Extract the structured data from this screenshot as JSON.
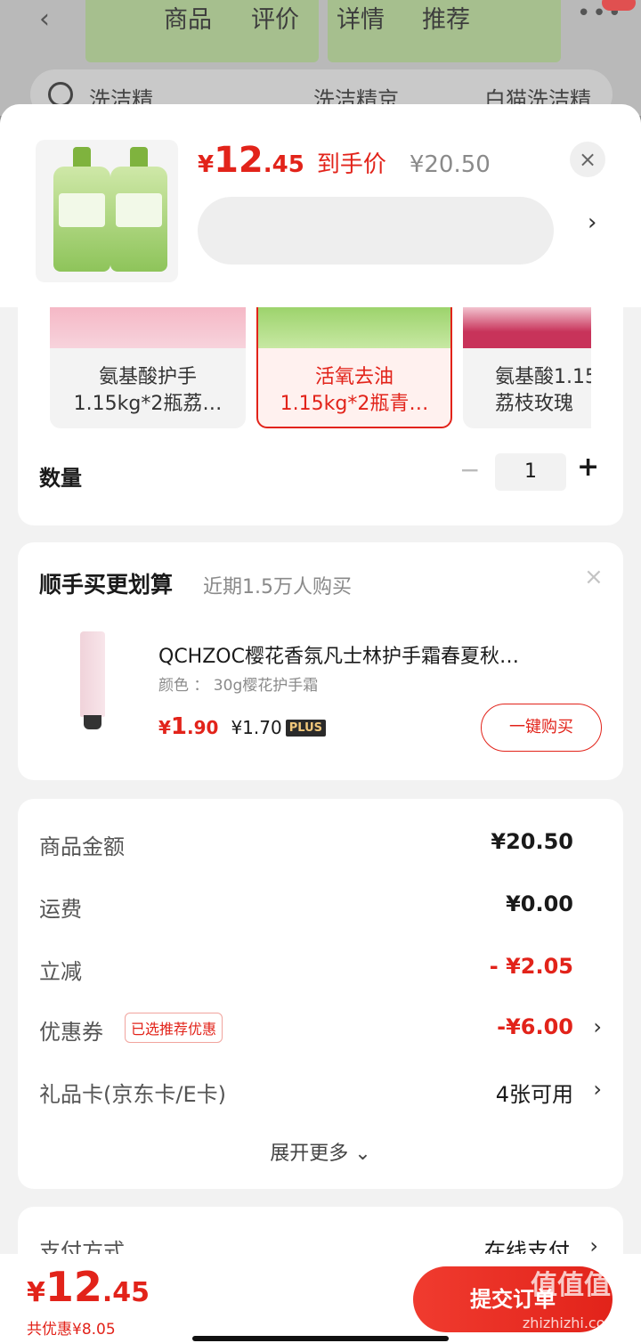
{
  "background": {
    "tabs": [
      "商品",
      "评价",
      "详情",
      "推荐"
    ],
    "search_keywords": [
      "洗洁精",
      "洗洁精京…",
      "白猫洗洁精"
    ]
  },
  "header": {
    "price_symbol": "¥",
    "price_int": "12",
    "price_dec": ".45",
    "price_tag": "到手价",
    "original_price": "¥20.50",
    "close": "×",
    "arrow": "›"
  },
  "variants": [
    {
      "name1": "氨基酸护手",
      "name2": "1.15kg*2瓶荔…",
      "selected": false
    },
    {
      "name1": "活氧去油",
      "name2": "1.15kg*2瓶青…",
      "selected": true
    },
    {
      "name1": "氨基酸1.15",
      "name2": "荔枝玫瑰",
      "selected": false
    }
  ],
  "quantity": {
    "label": "数量",
    "minus": "−",
    "value": "1",
    "plus": "+"
  },
  "addon": {
    "title": "顺手买更划算",
    "subtitle": "近期1.5万人购买",
    "close": "×",
    "product_name": "QCHZOC樱花香氛凡士林护手霜春夏秋…",
    "spec": "颜色 ： 30g樱花护手霜",
    "price_symbol": "¥",
    "price_int": "1",
    "price_dec": ".90",
    "plus_price": "¥1.70",
    "plus_badge": "PLUS",
    "buy_label": "一键购买"
  },
  "totals": {
    "rows": [
      {
        "label": "商品金额",
        "value": "¥20.50"
      },
      {
        "label": "运费",
        "value": "¥0.00"
      },
      {
        "label": "立减",
        "value": "- ¥2.05"
      },
      {
        "label": "优惠券",
        "value": "-¥6.00",
        "tag": "已选推荐优惠"
      },
      {
        "label": "礼品卡(京东卡/E卡)",
        "value": "4张可用"
      }
    ],
    "expand_label": "展开更多 ⌄"
  },
  "payment": {
    "label": "支付方式",
    "value": "在线支付"
  },
  "bottom": {
    "price_symbol": "¥",
    "price_int": "12",
    "price_dec": ".45",
    "savings": "共优惠¥8.05",
    "submit_label": "提交订单"
  },
  "watermark": {
    "text": "值值值",
    "url": "zhizhizhi.com"
  },
  "colors": {
    "accent": "#e2231a",
    "background": "#f2f2f2"
  }
}
